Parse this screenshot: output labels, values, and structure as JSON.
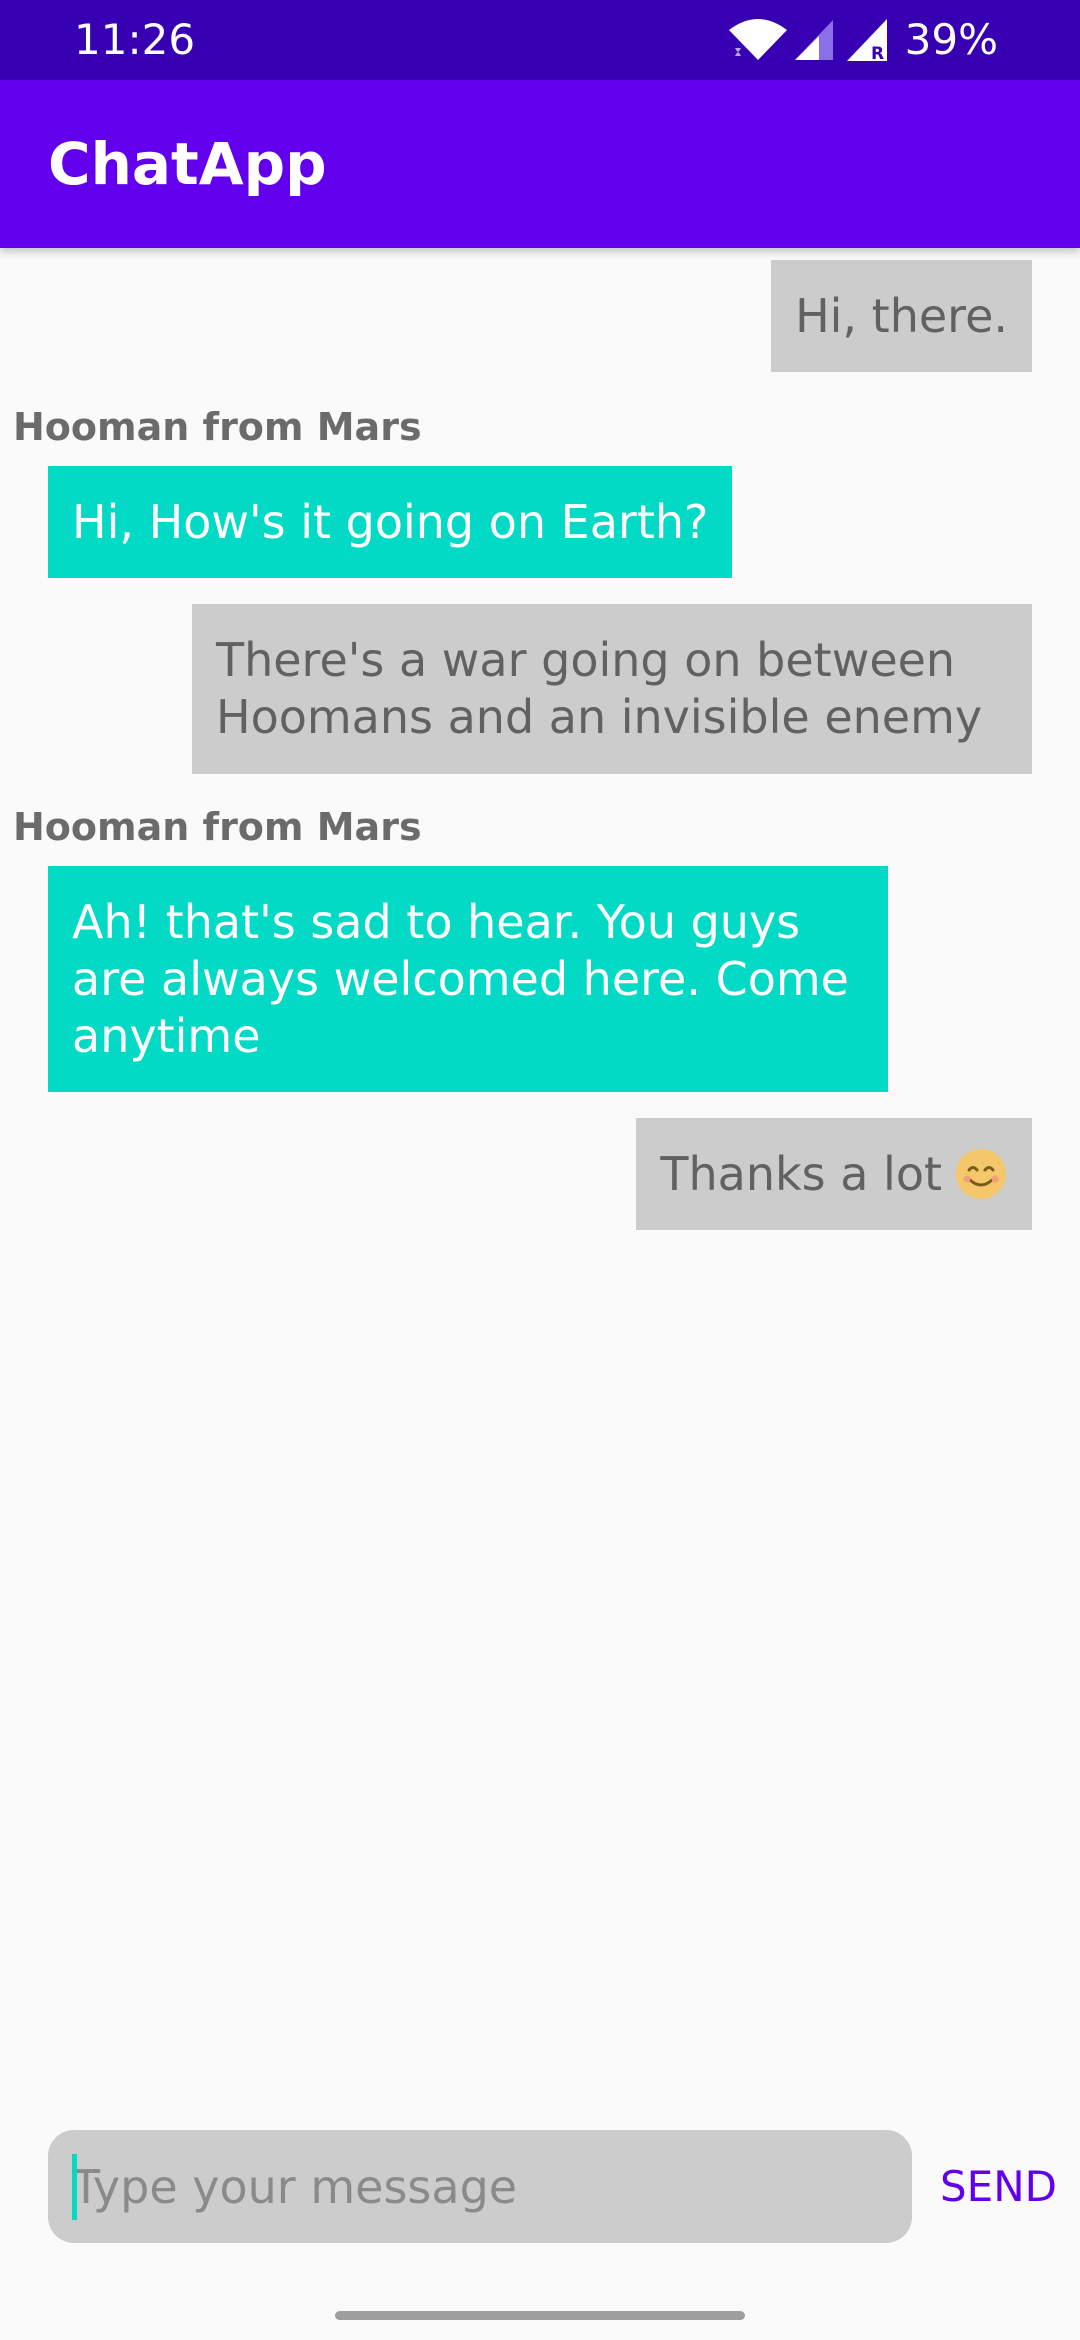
{
  "status_bar": {
    "time": "11:26",
    "battery": "39%",
    "icons": [
      "wifi-icon",
      "signal-icon",
      "signal-roaming-icon"
    ]
  },
  "app_bar": {
    "title": "ChatApp",
    "color": "#6200ee"
  },
  "messages": [
    {
      "from": "me",
      "text": "Hi, there."
    },
    {
      "from": "them",
      "sender": "Hooman from Mars",
      "text": "Hi, How's it going on Earth?"
    },
    {
      "from": "me",
      "lines": [
        "There's a war going on between",
        "Hoomans and an invisible enemy"
      ]
    },
    {
      "from": "them",
      "sender": "Hooman from Mars",
      "lines": [
        "Ah! that's sad to hear. You guys",
        "are always welcomed here. Come",
        "anytime"
      ]
    },
    {
      "from": "me",
      "text": "Thanks a lot",
      "emoji": "smiling-face-icon"
    }
  ],
  "composer": {
    "placeholder": "Type your message",
    "value": "",
    "send_label": "SEND"
  },
  "colors": {
    "status_bar": "#3700b3",
    "primary": "#6200ee",
    "accent": "#03dac5",
    "my_bubble": "#cccccc"
  }
}
